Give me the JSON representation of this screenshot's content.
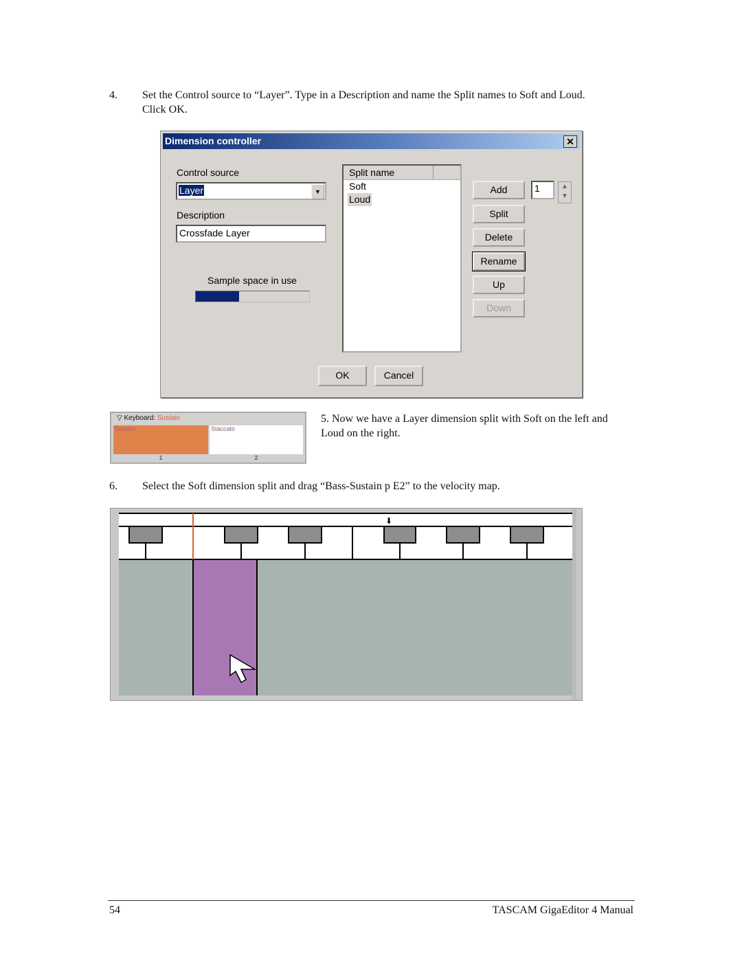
{
  "step4": {
    "number": "4.",
    "text_line1": "Set the Control source to “Layer”.  Type in a Description and name the Split names to Soft and Loud.",
    "text_line2": "Click OK."
  },
  "dialog": {
    "title": "Dimension controller",
    "close_icon": "close-icon",
    "control_source_label": "Control source",
    "control_source_value": "Layer",
    "description_label": "Description",
    "description_value": "Crossfade Layer",
    "sample_space_label": "Sample space in use",
    "sample_space_fraction": 0.38,
    "split_header": "Split name",
    "splits": [
      "Soft",
      "Loud"
    ],
    "buttons": {
      "add": "Add",
      "split": "Split",
      "delete": "Delete",
      "rename": "Rename",
      "up": "Up",
      "down": "Down",
      "ok": "OK",
      "cancel": "Cancel"
    },
    "count_value": "1",
    "progress_color": "#0a2470"
  },
  "keyboard_panel": {
    "title": "Keyboard",
    "title_value": "Sustain",
    "zones": [
      {
        "name": "Sustain",
        "number": "1",
        "color": "#e0834a"
      },
      {
        "name": "Staccato",
        "number": "2",
        "color": "#ffffff"
      }
    ]
  },
  "step5": {
    "text_line1": "5. Now we have a Layer dimension split with Soft on the left and",
    "text_line2": "Loud on the right."
  },
  "step6": {
    "number": "6.",
    "text": "Select the Soft dimension split and drag “Bass-Sustain p E2” to the velocity map."
  },
  "velocity_map": {
    "highlight_color": "#a878b4",
    "background_color": "#a8b4b0",
    "marker_color": "#e06030"
  },
  "footer": {
    "page_number": "54",
    "manual_title": "TASCAM GigaEditor 4 Manual"
  }
}
